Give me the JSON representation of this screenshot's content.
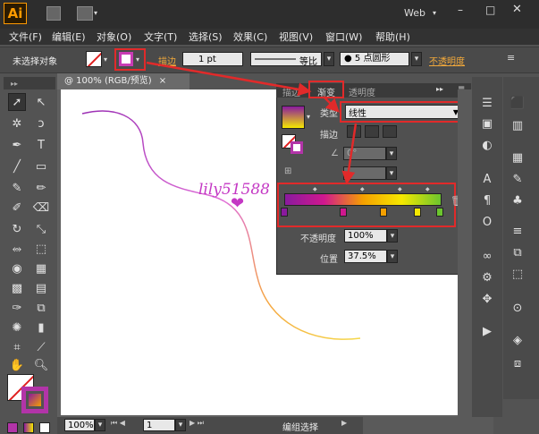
{
  "app": {
    "logo": "Ai",
    "workspace": "Web"
  },
  "window": {
    "minimize": "–",
    "restore": "□",
    "close": "✕"
  },
  "menu": [
    "文件(F)",
    "编辑(E)",
    "对象(O)",
    "文字(T)",
    "选择(S)",
    "效果(C)",
    "视图(V)",
    "窗口(W)",
    "帮助(H)"
  ],
  "control": {
    "no_selection": "未选择对象",
    "stroke_label": "描边",
    "stroke_weight": "1 pt",
    "stroke_style": "等比",
    "brush": "5 点圆形",
    "opacity_label": "不透明度"
  },
  "document": {
    "tab": "@ 100% (RGB/预览)",
    "tab_close": "×"
  },
  "gradient_panel": {
    "tabs": [
      "描边",
      "渐变",
      "透明度"
    ],
    "type_label": "类型",
    "type_value": "线性",
    "stroke_label": "描边",
    "angle_value": "0°",
    "opacity_label": "不透明度",
    "opacity_value": "100%",
    "location_label": "位置",
    "location_value": "37.5%",
    "gradient_colors": [
      "#8a1a9e",
      "#d0188f",
      "#f5a000",
      "#f5e800",
      "#6cc52e"
    ]
  },
  "canvas": {
    "watermark": "lily51588"
  },
  "status": {
    "zoom": "100%",
    "page": "1",
    "tool": "编组选择"
  }
}
